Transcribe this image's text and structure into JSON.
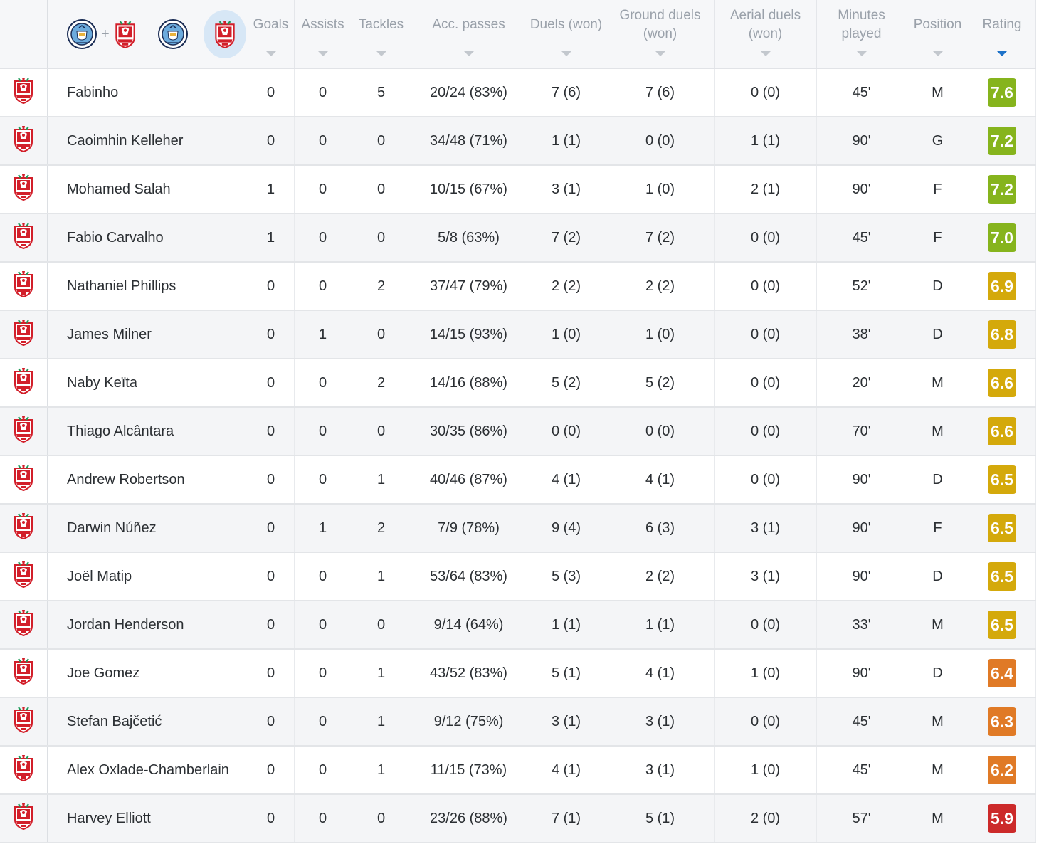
{
  "header": {
    "columns": [
      {
        "key": "goals",
        "label": "Goals"
      },
      {
        "key": "assists",
        "label": "Assists"
      },
      {
        "key": "tackles",
        "label": "Tackles"
      },
      {
        "key": "acc_passes",
        "label": "Acc. passes"
      },
      {
        "key": "duels",
        "label": "Duels (won)"
      },
      {
        "key": "ground_duels",
        "label": "Ground duels (won)"
      },
      {
        "key": "aerial_duels",
        "label": "Aerial duels (won)"
      },
      {
        "key": "minutes",
        "label": "Minutes played"
      },
      {
        "key": "position",
        "label": "Position"
      },
      {
        "key": "rating",
        "label": "Rating"
      }
    ],
    "team_filter": {
      "combined": "+",
      "selected": "liverpool"
    }
  },
  "colors": {
    "rating_green": "#86b41d",
    "rating_yellow": "#d4a90b",
    "rating_orange": "#e07a26",
    "rating_red": "#cc2a2a",
    "sort_active": "#1e73c9"
  },
  "players": [
    {
      "name": "Fabinho",
      "goals": "0",
      "assists": "0",
      "tackles": "5",
      "acc_passes": "20/24 (83%)",
      "duels": "7 (6)",
      "ground_duels": "7 (6)",
      "aerial_duels": "0 (0)",
      "minutes": "45'",
      "position": "M",
      "rating": "7.6",
      "rating_color": "#86b41d"
    },
    {
      "name": "Caoimhin Kelleher",
      "goals": "0",
      "assists": "0",
      "tackles": "0",
      "acc_passes": "34/48 (71%)",
      "duels": "1 (1)",
      "ground_duels": "0 (0)",
      "aerial_duels": "1 (1)",
      "minutes": "90'",
      "position": "G",
      "rating": "7.2",
      "rating_color": "#86b41d"
    },
    {
      "name": "Mohamed Salah",
      "goals": "1",
      "assists": "0",
      "tackles": "0",
      "acc_passes": "10/15 (67%)",
      "duels": "3 (1)",
      "ground_duels": "1 (0)",
      "aerial_duels": "2 (1)",
      "minutes": "90'",
      "position": "F",
      "rating": "7.2",
      "rating_color": "#86b41d"
    },
    {
      "name": "Fabio Carvalho",
      "goals": "1",
      "assists": "0",
      "tackles": "0",
      "acc_passes": "5/8 (63%)",
      "duels": "7 (2)",
      "ground_duels": "7 (2)",
      "aerial_duels": "0 (0)",
      "minutes": "45'",
      "position": "F",
      "rating": "7.0",
      "rating_color": "#86b41d"
    },
    {
      "name": "Nathaniel Phillips",
      "goals": "0",
      "assists": "0",
      "tackles": "2",
      "acc_passes": "37/47 (79%)",
      "duels": "2 (2)",
      "ground_duels": "2 (2)",
      "aerial_duels": "0 (0)",
      "minutes": "52'",
      "position": "D",
      "rating": "6.9",
      "rating_color": "#d4a90b"
    },
    {
      "name": "James Milner",
      "goals": "0",
      "assists": "1",
      "tackles": "0",
      "acc_passes": "14/15 (93%)",
      "duels": "1 (0)",
      "ground_duels": "1 (0)",
      "aerial_duels": "0 (0)",
      "minutes": "38'",
      "position": "D",
      "rating": "6.8",
      "rating_color": "#d4a90b"
    },
    {
      "name": "Naby Keïta",
      "goals": "0",
      "assists": "0",
      "tackles": "2",
      "acc_passes": "14/16 (88%)",
      "duels": "5 (2)",
      "ground_duels": "5 (2)",
      "aerial_duels": "0 (0)",
      "minutes": "20'",
      "position": "M",
      "rating": "6.6",
      "rating_color": "#d4a90b"
    },
    {
      "name": "Thiago Alcântara",
      "goals": "0",
      "assists": "0",
      "tackles": "0",
      "acc_passes": "30/35 (86%)",
      "duels": "0 (0)",
      "ground_duels": "0 (0)",
      "aerial_duels": "0 (0)",
      "minutes": "70'",
      "position": "M",
      "rating": "6.6",
      "rating_color": "#d4a90b"
    },
    {
      "name": "Andrew Robertson",
      "goals": "0",
      "assists": "0",
      "tackles": "1",
      "acc_passes": "40/46 (87%)",
      "duels": "4 (1)",
      "ground_duels": "4 (1)",
      "aerial_duels": "0 (0)",
      "minutes": "90'",
      "position": "D",
      "rating": "6.5",
      "rating_color": "#d4a90b"
    },
    {
      "name": "Darwin Núñez",
      "goals": "0",
      "assists": "1",
      "tackles": "2",
      "acc_passes": "7/9 (78%)",
      "duels": "9 (4)",
      "ground_duels": "6 (3)",
      "aerial_duels": "3 (1)",
      "minutes": "90'",
      "position": "F",
      "rating": "6.5",
      "rating_color": "#d4a90b"
    },
    {
      "name": "Joël Matip",
      "goals": "0",
      "assists": "0",
      "tackles": "1",
      "acc_passes": "53/64 (83%)",
      "duels": "5 (3)",
      "ground_duels": "2 (2)",
      "aerial_duels": "3 (1)",
      "minutes": "90'",
      "position": "D",
      "rating": "6.5",
      "rating_color": "#d4a90b"
    },
    {
      "name": "Jordan Henderson",
      "goals": "0",
      "assists": "0",
      "tackles": "0",
      "acc_passes": "9/14 (64%)",
      "duels": "1 (1)",
      "ground_duels": "1 (1)",
      "aerial_duels": "0 (0)",
      "minutes": "33'",
      "position": "M",
      "rating": "6.5",
      "rating_color": "#d4a90b"
    },
    {
      "name": "Joe Gomez",
      "goals": "0",
      "assists": "0",
      "tackles": "1",
      "acc_passes": "43/52 (83%)",
      "duels": "5 (1)",
      "ground_duels": "4 (1)",
      "aerial_duels": "1 (0)",
      "minutes": "90'",
      "position": "D",
      "rating": "6.4",
      "rating_color": "#e07a26"
    },
    {
      "name": "Stefan Bajčetić",
      "goals": "0",
      "assists": "0",
      "tackles": "1",
      "acc_passes": "9/12 (75%)",
      "duels": "3 (1)",
      "ground_duels": "3 (1)",
      "aerial_duels": "0 (0)",
      "minutes": "45'",
      "position": "M",
      "rating": "6.3",
      "rating_color": "#e07a26"
    },
    {
      "name": "Alex Oxlade-Chamberlain",
      "goals": "0",
      "assists": "0",
      "tackles": "1",
      "acc_passes": "11/15 (73%)",
      "duels": "4 (1)",
      "ground_duels": "3 (1)",
      "aerial_duels": "1 (0)",
      "minutes": "45'",
      "position": "M",
      "rating": "6.2",
      "rating_color": "#e07a26"
    },
    {
      "name": "Harvey Elliott",
      "goals": "0",
      "assists": "0",
      "tackles": "0",
      "acc_passes": "23/26 (88%)",
      "duels": "7 (1)",
      "ground_duels": "5 (1)",
      "aerial_duels": "2 (0)",
      "minutes": "57'",
      "position": "M",
      "rating": "5.9",
      "rating_color": "#cc2a2a"
    }
  ]
}
